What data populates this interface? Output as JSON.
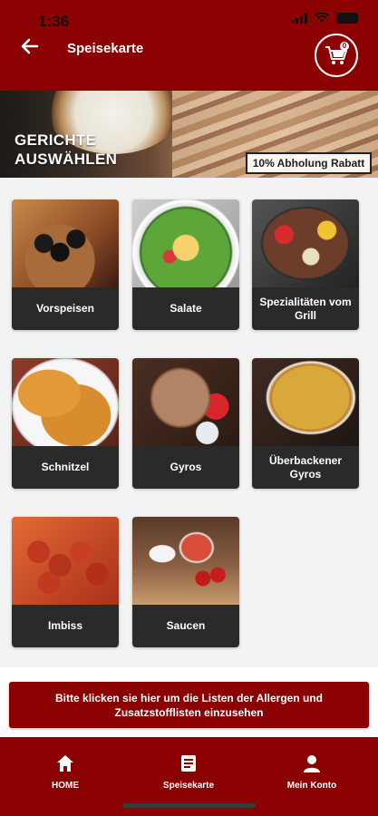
{
  "status_bar": {
    "time": "1:36"
  },
  "header": {
    "title": "Speisekarte",
    "cart_count": "0"
  },
  "hero": {
    "title": "GERICHTE AUSWÄHLEN",
    "promo": "10% Abholung Rabatt"
  },
  "categories": [
    {
      "label": "Vorspeisen"
    },
    {
      "label": "Salate"
    },
    {
      "label": "Spezialitäten vom Grill"
    },
    {
      "label": "Schnitzel"
    },
    {
      "label": "Gyros"
    },
    {
      "label": "Überbackener Gyros"
    },
    {
      "label": "Imbiss"
    },
    {
      "label": "Saucen"
    }
  ],
  "allergen_button": {
    "label": "Bitte klicken sie hier um die Listen der Allergen und Zusatzstofflisten einzusehen"
  },
  "bottom_nav": [
    {
      "label": "HOME",
      "icon": "home-icon"
    },
    {
      "label": "Speisekarte",
      "icon": "menu-icon"
    },
    {
      "label": "Mein Konto",
      "icon": "user-icon"
    }
  ],
  "colors": {
    "primary": "#8b0000",
    "card_label_bg": "#2a2a2a",
    "background": "#f3f3f3"
  }
}
